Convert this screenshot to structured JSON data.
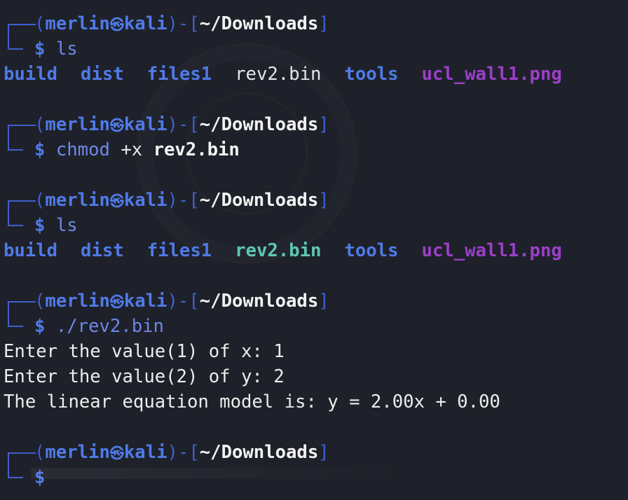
{
  "prompt": {
    "user": "merlin",
    "at_symbol": "㉿",
    "host": "kali",
    "path": "~/Downloads",
    "symbol": "$"
  },
  "entries": [
    {
      "command": "ls",
      "args": "",
      "listing": [
        "build",
        "dist",
        "files1",
        "rev2.bin",
        "tools",
        "ucl_wall1.png"
      ]
    },
    {
      "command": "chmod",
      "args": "+x",
      "target": "rev2.bin"
    },
    {
      "command": "ls",
      "args": "",
      "listing": [
        "build",
        "dist",
        "files1",
        "rev2.bin",
        "tools",
        "ucl_wall1.png"
      ]
    },
    {
      "command": "./rev2.bin",
      "output": [
        "Enter the value(1) of x: 1",
        "Enter the value(2) of y: 2",
        "The linear equation model is: y = 2.00x + 0.00"
      ]
    }
  ],
  "colors": {
    "background": "#1e2129",
    "prompt_blue": "#4f7ae8",
    "frame_blue": "#3f5fcf",
    "executable_green": "#5ec9b3",
    "image_purple": "#9b3fc9",
    "text": "#e6e6e6"
  }
}
